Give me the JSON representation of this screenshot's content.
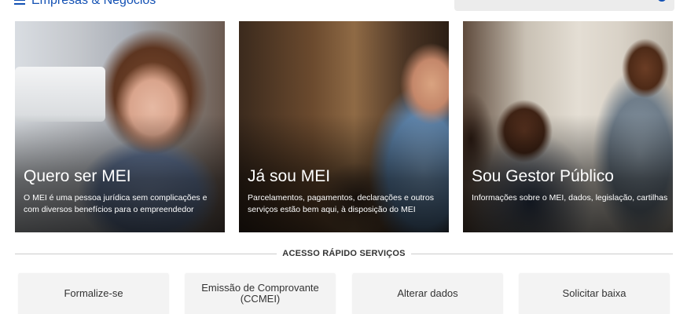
{
  "header": {
    "site_title": "Empresas & Negócios",
    "menu_icon": "hamburger-menu-icon",
    "search_icon": "search-icon"
  },
  "cards": [
    {
      "title": "Quero ser MEI",
      "description": "O MEI é uma pessoa jurídica sem complicações e com diversos benefícios para o empreendedor"
    },
    {
      "title": "Já sou MEI",
      "description": "Parcelamentos, pagamentos, declarações e outros serviços estão bem aqui, à disposição do MEI"
    },
    {
      "title": "Sou Gestor Público",
      "description": "Informações sobre o MEI, dados, legislação, cartilhas"
    }
  ],
  "quick_access": {
    "heading": "ACESSO RÁPIDO SERVIÇOS",
    "buttons": [
      "Formalize-se",
      "Emissão de Comprovante (CCMEI)",
      "Alterar dados",
      "Solicitar baixa"
    ]
  },
  "colors": {
    "brand_blue": "#1351b4",
    "button_bg": "#f3f3f3",
    "text_dark": "#333333"
  }
}
